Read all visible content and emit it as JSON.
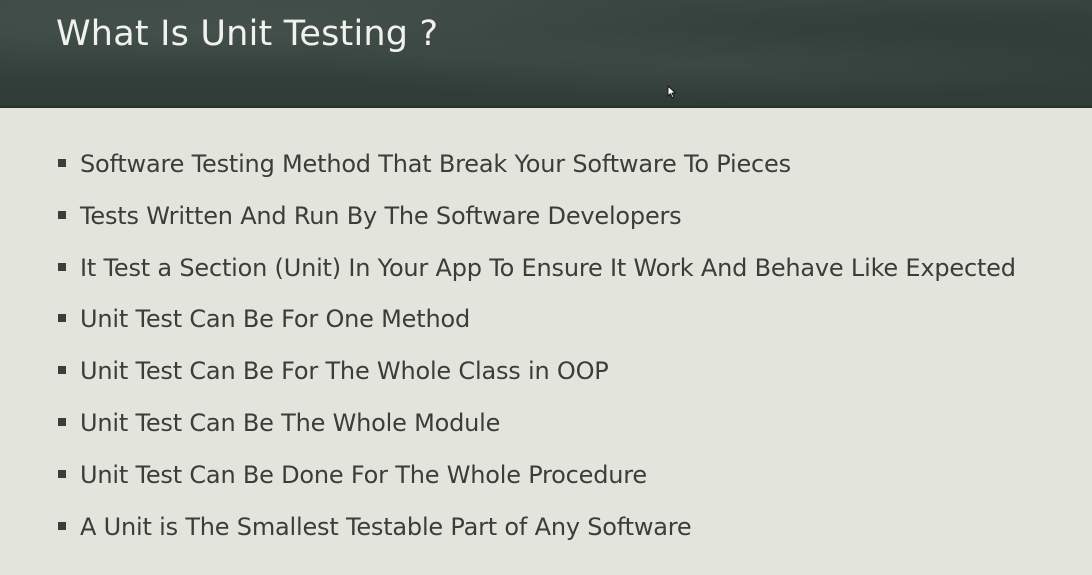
{
  "slide": {
    "title": "What Is Unit Testing ?",
    "bullets": [
      "Software Testing Method That Break Your Software To Pieces",
      "Tests Written And Run By The Software Developers",
      "It Test a Section (Unit) In Your App To Ensure It Work And Behave Like Expected",
      "Unit Test Can Be For One Method",
      "Unit Test Can Be For The Whole Class in OOP",
      "Unit Test Can Be The Whole Module",
      "Unit Test Can Be Done For The Whole Procedure",
      "A Unit is The Smallest Testable Part of Any Software"
    ]
  },
  "icons": {
    "bullet": "square-bullet-icon",
    "cursor": "mouse-cursor-icon"
  },
  "colors": {
    "header_background": "#36433e",
    "title_text": "#f1f2ec",
    "body_background": "#e3e5dc",
    "body_text": "#3a3d3a"
  }
}
